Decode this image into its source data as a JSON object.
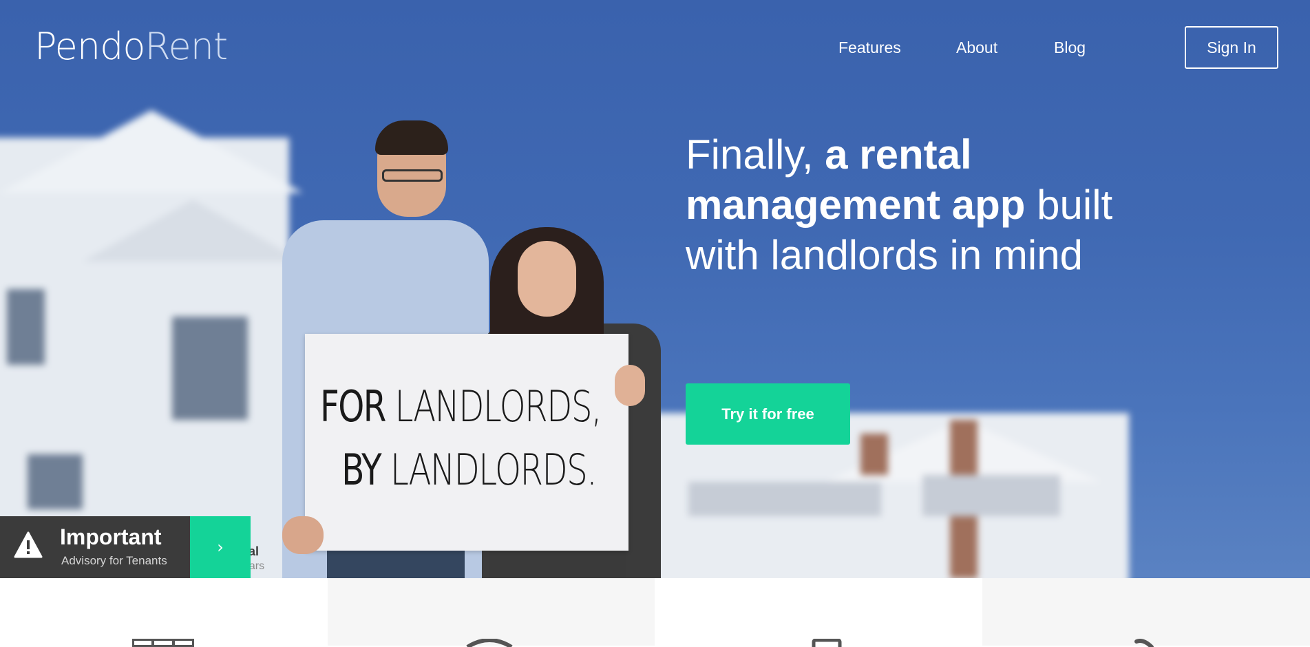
{
  "nav": {
    "logo_part1": "Pendo",
    "logo_part2": "Rent",
    "links": [
      "Features",
      "About",
      "Blog"
    ],
    "signin_label": "Sign In"
  },
  "hero": {
    "headline_light1": "Finally, ",
    "headline_bold": "a rental management app",
    "headline_light2": "built with landlords in mind",
    "cta_label": "Try it for free",
    "sign_line1_bold": "FOR",
    "sign_line1_rest": "LANDLORDS,",
    "sign_line2_bold": "BY",
    "sign_line2_rest": "LANDLORDS."
  },
  "advisory": {
    "title": "Important",
    "subtitle": "Advisory for Tenants",
    "go_icon": "chevron-right-icon",
    "warn_icon": "warning-triangle-icon",
    "behind_text_1": "stal",
    "behind_text_2": "years"
  },
  "features": {
    "icons": [
      "calendar-icon",
      "clock-icon",
      "phone-icon",
      "tool-icon"
    ]
  },
  "colors": {
    "accent": "#14d398",
    "hero_blue": "#3a62ad",
    "dark_bar": "#3b3b3b"
  }
}
